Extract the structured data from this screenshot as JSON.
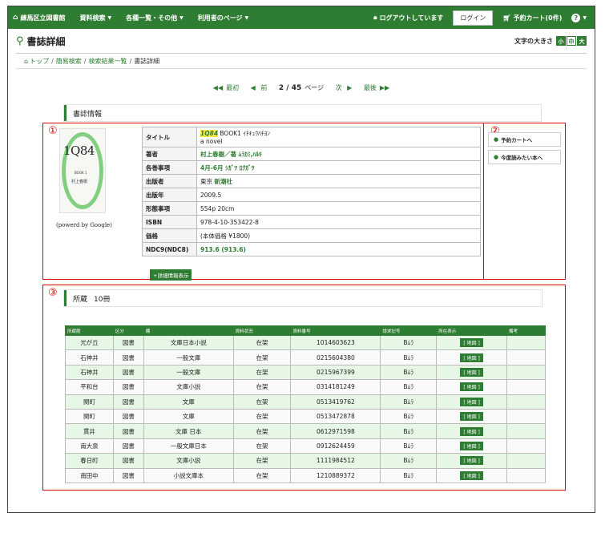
{
  "nav": {
    "library": "練馬区立図書館",
    "items": [
      "資料検索",
      "各種一覧・その他",
      "利用者のページ"
    ],
    "logout_status": "ログアウトしています",
    "login": "ログイン",
    "cart": "予約カート(0件)",
    "help_icon": "?"
  },
  "page": {
    "title": "書誌詳細",
    "font_size_label": "文字の大きさ",
    "font_sizes": [
      "小",
      "中",
      "大"
    ]
  },
  "breadcrumb": [
    "トップ",
    "簡易検索",
    "検索結果一覧",
    "書誌詳細"
  ],
  "pager": {
    "first": "最初",
    "prev": "前",
    "count": "2 / 45",
    "unit": "ページ",
    "next": "次",
    "last": "最後"
  },
  "bib": {
    "section_title": "書誌情報",
    "powered": "(powerd by Google)",
    "cover": {
      "title": "1Q84",
      "sub": "BOOK 1",
      "author": "村上春樹"
    },
    "rows": [
      {
        "label": "タイトル",
        "value_hl": "1Q84",
        "value": " BOOK1 ｲﾁｷｭｳﾊﾁﾖﾝ",
        "value2": "a novel"
      },
      {
        "label": "著者",
        "value": "村上春樹／著 ﾑﾗｶﾐ,ﾊﾙｷ",
        "link": true
      },
      {
        "label": "各巻事項",
        "value": "4月-6月 ｼｶﾞﾂ ﾛｸｶﾞﾂ",
        "link": true
      },
      {
        "label": "出版者",
        "value_plain": "東京 ",
        "value": "新潮社",
        "link": true
      },
      {
        "label": "出版年",
        "value": "2009.5"
      },
      {
        "label": "形態事項",
        "value": "554p 20cm"
      },
      {
        "label": "ISBN",
        "value": "978-4-10-353422-8"
      },
      {
        "label": "価格",
        "value": "(本体価格 ¥1800)"
      },
      {
        "label": "NDC9(NDC8)",
        "value": "913.6 (913.6)",
        "link": true
      }
    ],
    "more_button": "+詳細情報表示"
  },
  "side": {
    "reserve": "予約カートへ",
    "later": "今度読みたい本へ"
  },
  "markers": [
    "①",
    "②",
    "③"
  ],
  "holdings": {
    "section_title": "所蔵",
    "count": "10冊",
    "headers": [
      "所蔵館",
      "区分",
      "棚",
      "資料状況",
      "資料番号",
      "請求記号",
      "所在表示",
      "備考"
    ],
    "map_label": "[ 地図 ]",
    "rows": [
      [
        "光が丘",
        "図書",
        "文庫日本小説",
        "在架",
        "1014603623",
        "Bﾑﾗ",
        ""
      ],
      [
        "石神井",
        "図書",
        "一般文庫",
        "在架",
        "0215604380",
        "Bﾑﾗ",
        ""
      ],
      [
        "石神井",
        "図書",
        "一般文庫",
        "在架",
        "0215967399",
        "Bﾑﾗ",
        ""
      ],
      [
        "平和台",
        "図書",
        "文庫小説",
        "在架",
        "0314181249",
        "Bﾑﾗ",
        ""
      ],
      [
        "関町",
        "図書",
        "文庫",
        "在架",
        "0513419762",
        "Bﾑﾗ",
        ""
      ],
      [
        "関町",
        "図書",
        "文庫",
        "在架",
        "0513472878",
        "Bﾑﾗ",
        ""
      ],
      [
        "貫井",
        "図書",
        "文庫 日本",
        "在架",
        "0612971598",
        "Bﾑﾗ",
        ""
      ],
      [
        "南大泉",
        "図書",
        "一般文庫日本",
        "在架",
        "0912624459",
        "Bﾑﾗ",
        ""
      ],
      [
        "春日町",
        "図書",
        "文庫小説",
        "在架",
        "1111984512",
        "Bﾑﾗ",
        ""
      ],
      [
        "南田中",
        "図書",
        "小説文庫本",
        "在架",
        "1210889372",
        "Bﾑﾗ",
        ""
      ]
    ]
  }
}
